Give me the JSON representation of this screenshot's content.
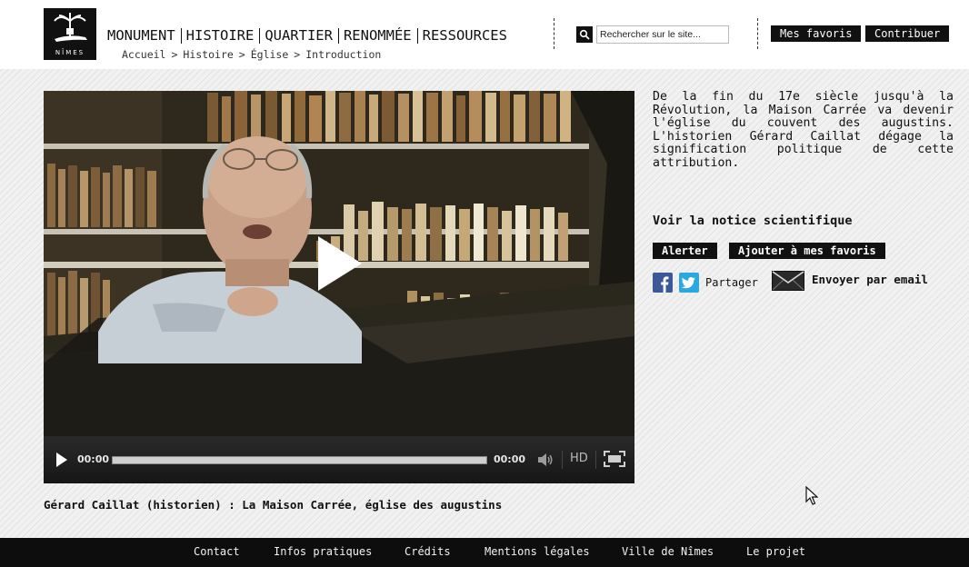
{
  "header": {
    "logo_text": "NÎMES",
    "nav": [
      "MONUMENT",
      "HISTOIRE",
      "QUARTIER",
      "RENOMMÉE",
      "RESSOURCES"
    ],
    "breadcrumb": [
      "Accueil",
      "Histoire",
      "Église",
      "Introduction"
    ],
    "breadcrumb_separator": ">",
    "search_placeholder": "Rechercher sur le site...",
    "favorites_button": "Mes favoris",
    "contribute_button": "Contribuer"
  },
  "video": {
    "current_time": "00:00",
    "duration": "00:00",
    "progress": 0,
    "hd_label": "HD",
    "caption": "Gérard Caillat (historien) : La Maison Carrée, église des augustins"
  },
  "aside": {
    "description": "De la fin du 17e siècle jusqu'à la Révolution, la Maison Carrée va devenir l'église du couvent des augustins. L'historien Gérard Caillat dégage la signification politique de cette attribution.",
    "notice_link": "Voir la notice scientifique",
    "alert_button": "Alerter",
    "add_favorites_button": "Ajouter à mes favoris",
    "share_label": "Partager",
    "email_label": "Envoyer par email"
  },
  "footer": {
    "links": [
      "Contact",
      "Infos pratiques",
      "Crédits",
      "Mentions légales",
      "Ville de Nîmes",
      "Le projet"
    ]
  },
  "colors": {
    "accent": "#111111",
    "facebook": "#3b5998",
    "twitter": "#2aa9e0",
    "footer_bg": "#0d0d0d"
  },
  "icons": [
    "search-icon",
    "play-icon",
    "volume-icon",
    "fullscreen-icon",
    "facebook-icon",
    "twitter-icon",
    "envelope-icon",
    "mouse-cursor-icon"
  ]
}
